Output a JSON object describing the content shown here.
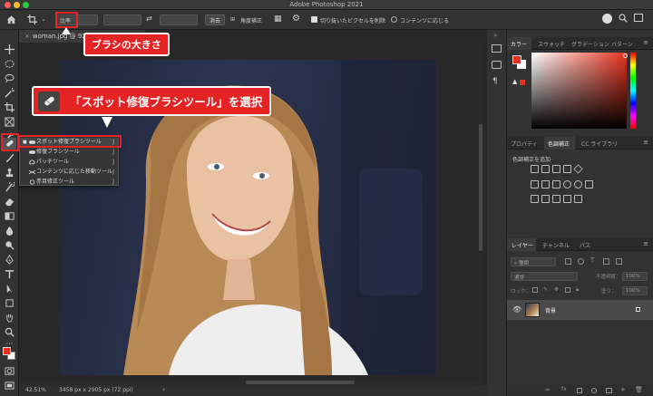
{
  "window": {
    "title": "Adobe Photoshop 2021"
  },
  "options_bar": {
    "ratio_label": "比率",
    "clear_button": "消去",
    "straighten_label": "角度補正",
    "delete_cropped_label": "切り抜いたピクセルを削除",
    "content_aware_label": "コンテンツに応じる"
  },
  "document": {
    "tab_title": "woman.jpg @ 92",
    "zoom": "42.51%",
    "dimensions": "3458 px x 2905 px (72 ppi)"
  },
  "flyout": {
    "items": [
      {
        "label": "スポット修復ブラシツール",
        "shortcut": "J"
      },
      {
        "label": "修復ブラシツール",
        "shortcut": "J"
      },
      {
        "label": "パッチツール",
        "shortcut": "J"
      },
      {
        "label": "コンテンツに応じた移動ツール",
        "shortcut": "J"
      },
      {
        "label": "赤目修正ツール",
        "shortcut": "J"
      }
    ]
  },
  "callouts": {
    "brush_size": "ブラシの大きさ",
    "select_tool": "「スポット修復ブラシツール」を選択"
  },
  "panels": {
    "color_tabs": [
      "カラー",
      "スウォッチ",
      "グラデーション",
      "パターン"
    ],
    "adjust_tabs": [
      "プロパティ",
      "色調補正",
      "CC ライブラリ"
    ],
    "adjust_add_label": "色調補正を追加",
    "layers_tabs": [
      "レイヤー",
      "チャンネル",
      "パス"
    ],
    "layers_kind": "種類",
    "layers_blend": "通常",
    "layers_opacity_label": "不透明度：",
    "layers_opacity": "100%",
    "layers_lock_label": "ロック：",
    "layers_fill_label": "塗り：",
    "layers_fill": "100%",
    "layer_name": "背景"
  },
  "colors": {
    "foreground": "#e8321e",
    "accent_red": "#e52325"
  }
}
